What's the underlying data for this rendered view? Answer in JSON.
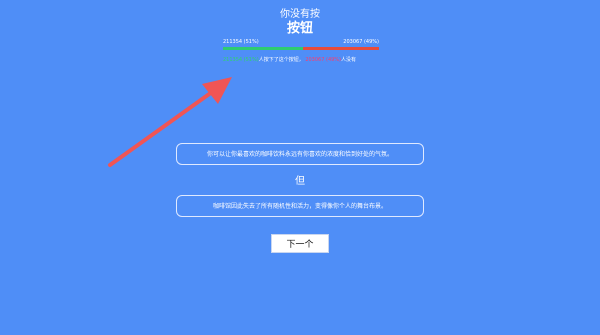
{
  "header": {
    "title_top": "你没有按",
    "title_main": "按钮"
  },
  "stats": {
    "yes_count": "211354 (51%)",
    "no_count": "203067 (49%)",
    "yes_fraction": 0.51,
    "bottom_yes": "211354 (51%)",
    "bottom_yes_text": "人按下了这个按钮，",
    "bottom_no": "203067 (49%)",
    "bottom_no_text": "人没有",
    "yes_color": "#2ecc71",
    "no_color": "#e74c3c"
  },
  "content": {
    "box1": "你可以让你最喜欢的咖啡饮料永远有你喜欢的浓度和恰到好处的气氛。",
    "but": "但",
    "box2": "咖啡馆因此失去了所有随机性和活力，变得像你个人的舞台布景。"
  },
  "buttons": {
    "next_label": "下一个"
  },
  "colors": {
    "background": "#4f8ef7",
    "arrow": "#f05555"
  },
  "icons": {
    "annotation": "arrow-icon"
  }
}
